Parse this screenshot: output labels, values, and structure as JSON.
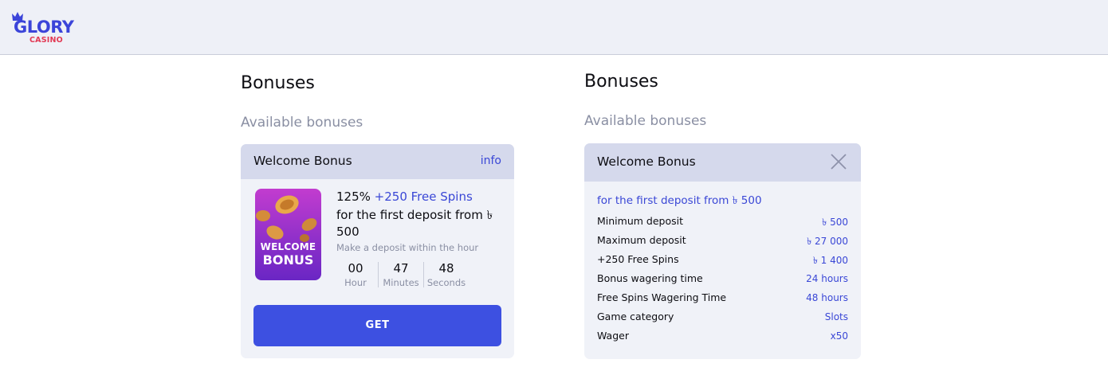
{
  "header": {
    "logo_main": "GLORY",
    "logo_sub": "CASINO"
  },
  "left": {
    "title": "Bonuses",
    "subtitle": "Available bonuses",
    "card": {
      "title": "Welcome Bonus",
      "info_label": "info",
      "image_text_line1": "WELCOME",
      "image_text_line2": "BONUS",
      "percent": "125%",
      "spins": "+250 Free Spins",
      "description": "for the first deposit from ৳ 500",
      "hint": "Make a deposit within the hour",
      "timer": [
        {
          "value": "00",
          "label": "Hour"
        },
        {
          "value": "47",
          "label": "Minutes"
        },
        {
          "value": "48",
          "label": "Seconds"
        }
      ],
      "button_label": "GET"
    }
  },
  "right": {
    "title": "Bonuses",
    "subtitle": "Available bonuses",
    "card": {
      "title": "Welcome Bonus",
      "first_deposit": "for the first deposit from  ৳ 500",
      "rows": [
        {
          "label": "Minimum deposit",
          "value": "৳ 500"
        },
        {
          "label": "Maximum deposit",
          "value": "৳ 27 000"
        },
        {
          "label": "+250 Free Spins",
          "value": "৳ 1 400"
        },
        {
          "label": "Bonus wagering time",
          "value": "24 hours"
        },
        {
          "label": "Free Spins Wagering Time",
          "value": "48 hours"
        },
        {
          "label": "Game category",
          "value": "Slots"
        },
        {
          "label": "Wager",
          "value": "x50"
        }
      ]
    }
  },
  "colors": {
    "accent": "#3d50e1",
    "link": "#3a47d6",
    "brand_red": "#e23a55"
  }
}
